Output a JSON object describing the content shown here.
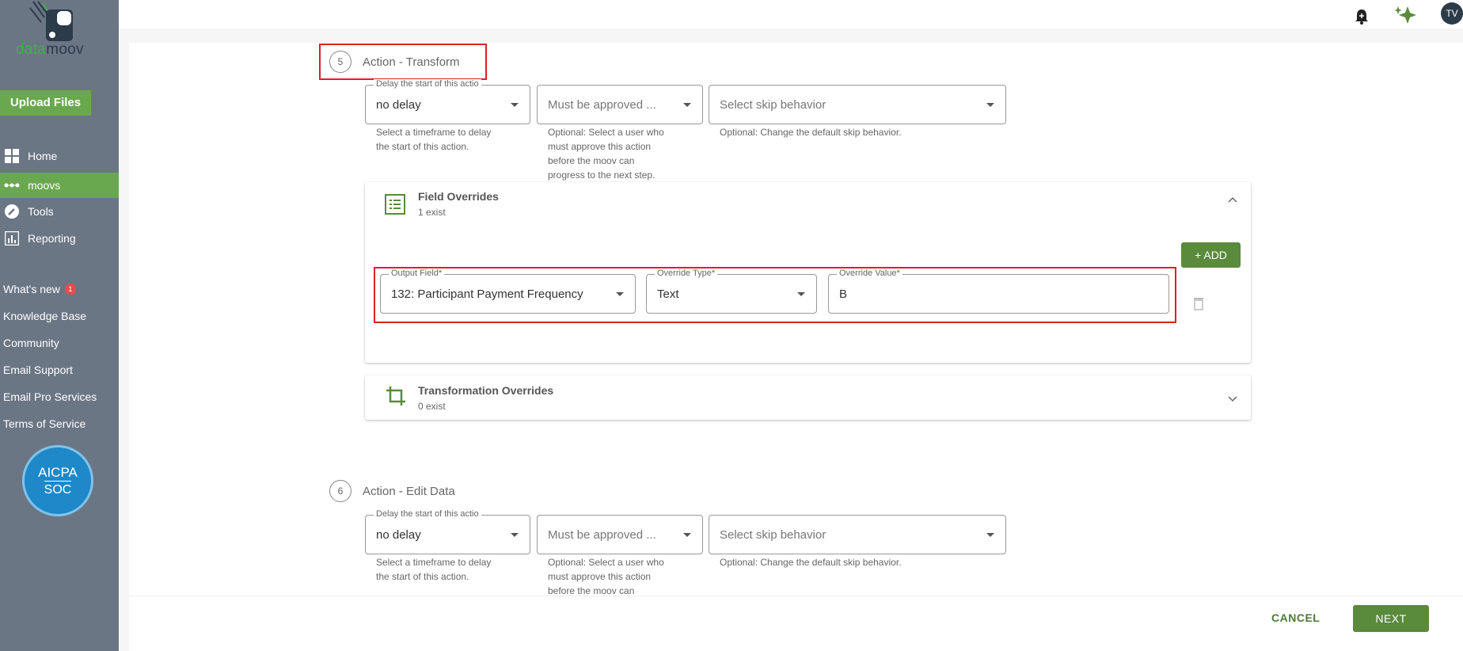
{
  "brand": {
    "logo_part1": "data",
    "logo_part2": "moov"
  },
  "sidebar": {
    "upload_label": "Upload Files",
    "nav": [
      {
        "label": "Home",
        "icon": "home-grid-icon"
      },
      {
        "label": "moovs",
        "icon": "moovs-dots-icon",
        "active": true
      },
      {
        "label": "Tools",
        "icon": "wrench-icon"
      },
      {
        "label": "Reporting",
        "icon": "chart-icon"
      }
    ],
    "links": [
      {
        "label": "What's new",
        "badge": "1"
      },
      {
        "label": "Knowledge Base"
      },
      {
        "label": "Community"
      },
      {
        "label": "Email Support"
      },
      {
        "label": "Email Pro Services"
      },
      {
        "label": "Terms of Service"
      }
    ],
    "soc_badge": {
      "line1": "AICPA",
      "line2": "SOC"
    }
  },
  "topbar": {
    "avatar_initials": "TV"
  },
  "step5": {
    "number": "5",
    "title": "Action - Transform",
    "delay": {
      "label": "Delay the start of this actio",
      "value": "no delay",
      "helper1": "Select a timeframe to delay",
      "helper2": "the start of this action."
    },
    "approve": {
      "placeholder": "Must be approved ...",
      "helper1": "Optional: Select a user who",
      "helper2": "must approve this action",
      "helper3": "before the moov can",
      "helper4": "progress to the next step."
    },
    "skip": {
      "placeholder": "Select skip behavior",
      "helper": "Optional: Change the default skip behavior."
    },
    "field_overrides": {
      "title": "Field Overrides",
      "count": "1 exist",
      "add_label": "+ ADD",
      "row": {
        "output_label": "Output Field*",
        "output_value": "132: Participant Payment Frequency",
        "type_label": "Override Type*",
        "type_value": "Text",
        "value_label": "Override Value*",
        "value_value": "B"
      }
    },
    "transformation_overrides": {
      "title": "Transformation Overrides",
      "count": "0 exist"
    }
  },
  "step6": {
    "number": "6",
    "title": "Action - Edit Data",
    "delay": {
      "label": "Delay the start of this actio",
      "value": "no delay",
      "helper1": "Select a timeframe to delay",
      "helper2": "the start of this action."
    },
    "approve": {
      "placeholder": "Must be approved ...",
      "helper1": "Optional: Select a user who",
      "helper2": "must approve this action",
      "helper3": "before the moov can"
    },
    "skip": {
      "placeholder": "Select skip behavior",
      "helper": "Optional: Change the default skip behavior."
    }
  },
  "footer": {
    "cancel_label": "CANCEL",
    "next_label": "NEXT"
  },
  "colors": {
    "sidebar": "#6b7685",
    "accent_green": "#6aa84f",
    "button_green": "#5a8a3c",
    "highlight_red": "#d9202b"
  }
}
